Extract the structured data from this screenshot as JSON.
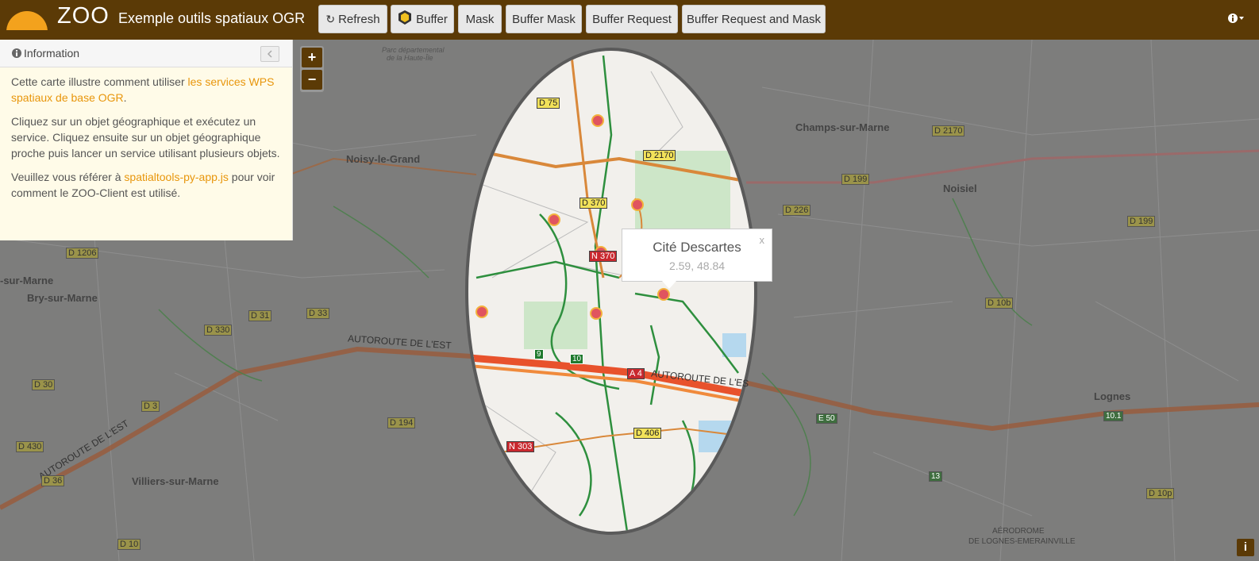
{
  "navbar": {
    "brand": "ZOO",
    "subtitle": "Exemple outils spatiaux OGR",
    "buttons": {
      "refresh": "Refresh",
      "buffer": "Buffer",
      "mask": "Mask",
      "buffer_mask": "Buffer Mask",
      "buffer_request": "Buffer Request",
      "buffer_request_mask": "Buffer Request and Mask"
    }
  },
  "panel": {
    "title": "Information",
    "p1_a": "Cette carte illustre comment utiliser ",
    "p1_link": "les services WPS spatiaux de base OGR",
    "p1_b": ".",
    "p2": "Cliquez sur un objet géographique et exécutez un service. Cliquez ensuite sur un objet géographique proche puis lancer un service utilisant plusieurs objets.",
    "p3_a": "Veuillez vous référer à ",
    "p3_link": "spatialtools-py-app.js",
    "p3_b": " pour voir comment le ZOO-Client est utilisé."
  },
  "zoom": {
    "in": "+",
    "out": "−"
  },
  "popup": {
    "title": "Cité Descartes",
    "coords": "2.59, 48.84",
    "close": "x"
  },
  "attribution": "i",
  "map": {
    "places": [
      "Noisy-le-Grand",
      "Champs-sur-Marne",
      "Noisiel",
      "Bry-sur-Marne",
      "Villiers-sur-Marne",
      "Lognes",
      "-sur-Marne",
      "AÉRODROME",
      "DE LOGNES-EMERAINVILLE",
      "Parc départemental",
      "de la Haute-Île"
    ],
    "road_labels": [
      "D 75",
      "D 2170",
      "D 370",
      "N 370",
      "A 4",
      "D 406",
      "N 303",
      "D 199",
      "D 226",
      "D 1206",
      "D 330",
      "D 31",
      "D 33",
      "D 30",
      "D 3",
      "D 194",
      "D 430",
      "D 36",
      "D 10",
      "D 10b",
      "D 10p",
      "D 199",
      "D 2170",
      "E 50",
      "9",
      "10",
      "10.1",
      "13"
    ],
    "highways": [
      "AUTOROUTE DE L'EST",
      "AUTOROUTE DE L'ES",
      "AUTOROUTE DE L'EST"
    ]
  },
  "colors": {
    "navbar": "#5b3a06",
    "accent": "#e8960c",
    "dim": "#7a7a7a"
  }
}
